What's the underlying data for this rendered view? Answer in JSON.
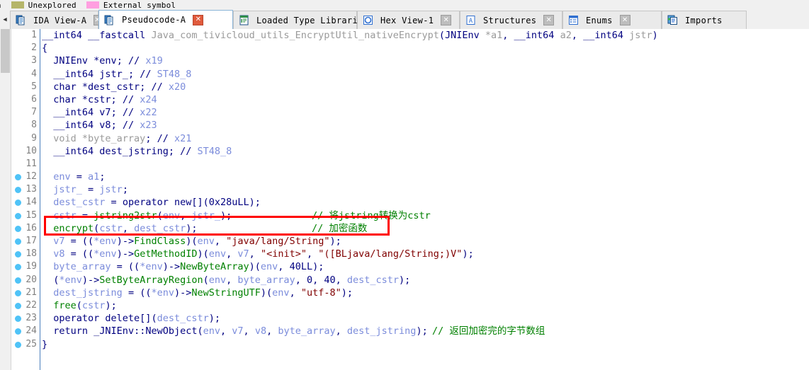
{
  "legend": {
    "truncated_prefix": "ta",
    "items": [
      {
        "label": "Unexplored",
        "color": "#b5b56a"
      },
      {
        "label": "External symbol",
        "color": "#ff9fe0"
      }
    ]
  },
  "tabbar": {
    "scroll_glyph": "◀",
    "close_glyph": "✕",
    "tabs": [
      {
        "label": "IDA View-A",
        "icon": "document-view-icon",
        "active": false,
        "closable": true
      },
      {
        "label": "Pseudocode-A",
        "icon": "pseudocode-icon",
        "active": true,
        "closable": true
      },
      {
        "label": "Loaded Type Libraries",
        "icon": "type-libraries-icon",
        "active": false,
        "closable": true
      },
      {
        "label": "Hex View-1",
        "icon": "hex-view-icon",
        "active": false,
        "closable": true
      },
      {
        "label": "Structures",
        "icon": "structures-icon",
        "active": false,
        "closable": true
      },
      {
        "label": "Enums",
        "icon": "enums-icon",
        "active": false,
        "closable": true
      },
      {
        "label": "Imports",
        "icon": "imports-icon",
        "active": false,
        "closable": false
      }
    ]
  },
  "annotation": {
    "color": "#ff0000",
    "target_line": 16,
    "label": "encrypt-call-highlight"
  },
  "editor": {
    "function_name": "Java_com_tivicloud_utils_EncryptUtil_nativeEncrypt",
    "breakpoint_lines": [
      12,
      13,
      14,
      15,
      16,
      17,
      18,
      19,
      20,
      21,
      22,
      23,
      24,
      25
    ],
    "lines": [
      {
        "n": 1,
        "tokens": [
          {
            "t": "__int64 ",
            "c": "kw"
          },
          {
            "t": "__fastcall ",
            "c": "kw"
          },
          {
            "t": "Java_com_tivicloud_utils_EncryptUtil_nativeEncrypt",
            "c": "gray"
          },
          {
            "t": "(",
            "c": "pun"
          },
          {
            "t": "JNIEnv ",
            "c": "kw"
          },
          {
            "t": "*a1",
            "c": "gray"
          },
          {
            "t": ", ",
            "c": "pun"
          },
          {
            "t": "__int64 ",
            "c": "kw"
          },
          {
            "t": "a2",
            "c": "gray"
          },
          {
            "t": ", ",
            "c": "pun"
          },
          {
            "t": "__int64 ",
            "c": "kw"
          },
          {
            "t": "jstr",
            "c": "gray"
          },
          {
            "t": ")",
            "c": "pun"
          }
        ],
        "comment": ""
      },
      {
        "n": 2,
        "tokens": [
          {
            "t": "{",
            "c": "kw"
          }
        ],
        "comment": ""
      },
      {
        "n": 3,
        "tokens": [
          {
            "t": "  ",
            "c": "pun"
          },
          {
            "t": "JNIEnv ",
            "c": "kw"
          },
          {
            "t": "*env",
            "c": "kw"
          },
          {
            "t": "; ",
            "c": "pun"
          },
          {
            "t": "// ",
            "c": "kw"
          },
          {
            "t": "x19",
            "c": "var"
          }
        ],
        "comment": ""
      },
      {
        "n": 4,
        "tokens": [
          {
            "t": "  ",
            "c": "pun"
          },
          {
            "t": "__int64 ",
            "c": "kw"
          },
          {
            "t": "jstr_",
            "c": "kw"
          },
          {
            "t": "; ",
            "c": "pun"
          },
          {
            "t": "// ",
            "c": "kw"
          },
          {
            "t": "ST48_8",
            "c": "var"
          }
        ],
        "comment": ""
      },
      {
        "n": 5,
        "tokens": [
          {
            "t": "  ",
            "c": "pun"
          },
          {
            "t": "char ",
            "c": "kw"
          },
          {
            "t": "*dest_cstr",
            "c": "kw"
          },
          {
            "t": "; ",
            "c": "pun"
          },
          {
            "t": "// ",
            "c": "kw"
          },
          {
            "t": "x20",
            "c": "var"
          }
        ],
        "comment": ""
      },
      {
        "n": 6,
        "tokens": [
          {
            "t": "  ",
            "c": "pun"
          },
          {
            "t": "char ",
            "c": "kw"
          },
          {
            "t": "*cstr",
            "c": "kw"
          },
          {
            "t": "; ",
            "c": "pun"
          },
          {
            "t": "// ",
            "c": "kw"
          },
          {
            "t": "x24",
            "c": "var"
          }
        ],
        "comment": ""
      },
      {
        "n": 7,
        "tokens": [
          {
            "t": "  ",
            "c": "pun"
          },
          {
            "t": "__int64 ",
            "c": "kw"
          },
          {
            "t": "v7",
            "c": "kw"
          },
          {
            "t": "; ",
            "c": "pun"
          },
          {
            "t": "// ",
            "c": "kw"
          },
          {
            "t": "x22",
            "c": "var"
          }
        ],
        "comment": ""
      },
      {
        "n": 8,
        "tokens": [
          {
            "t": "  ",
            "c": "pun"
          },
          {
            "t": "__int64 ",
            "c": "kw"
          },
          {
            "t": "v8",
            "c": "kw"
          },
          {
            "t": "; ",
            "c": "pun"
          },
          {
            "t": "// ",
            "c": "kw"
          },
          {
            "t": "x23",
            "c": "var"
          }
        ],
        "comment": ""
      },
      {
        "n": 9,
        "tokens": [
          {
            "t": "  ",
            "c": "pun"
          },
          {
            "t": "void ",
            "c": "gray"
          },
          {
            "t": "*byte_array",
            "c": "gray"
          },
          {
            "t": "; ",
            "c": "pun"
          },
          {
            "t": "// ",
            "c": "kw"
          },
          {
            "t": "x21",
            "c": "var"
          }
        ],
        "comment": ""
      },
      {
        "n": 10,
        "tokens": [
          {
            "t": "  ",
            "c": "pun"
          },
          {
            "t": "__int64 ",
            "c": "kw"
          },
          {
            "t": "dest_jstring",
            "c": "kw"
          },
          {
            "t": "; ",
            "c": "pun"
          },
          {
            "t": "// ",
            "c": "kw"
          },
          {
            "t": "ST48_8",
            "c": "var"
          }
        ],
        "comment": ""
      },
      {
        "n": 11,
        "tokens": [],
        "comment": ""
      },
      {
        "n": 12,
        "tokens": [
          {
            "t": "  ",
            "c": "pun"
          },
          {
            "t": "env",
            "c": "var"
          },
          {
            "t": " = ",
            "c": "pun"
          },
          {
            "t": "a1",
            "c": "var"
          },
          {
            "t": ";",
            "c": "pun"
          }
        ],
        "comment": ""
      },
      {
        "n": 13,
        "tokens": [
          {
            "t": "  ",
            "c": "pun"
          },
          {
            "t": "jstr_",
            "c": "var"
          },
          {
            "t": " = ",
            "c": "pun"
          },
          {
            "t": "jstr",
            "c": "var"
          },
          {
            "t": ";",
            "c": "pun"
          }
        ],
        "comment": ""
      },
      {
        "n": 14,
        "tokens": [
          {
            "t": "  ",
            "c": "pun"
          },
          {
            "t": "dest_cstr",
            "c": "var"
          },
          {
            "t": " = ",
            "c": "pun"
          },
          {
            "t": "operator new[]",
            "c": "kw"
          },
          {
            "t": "(",
            "c": "pun"
          },
          {
            "t": "0x28uLL",
            "c": "num"
          },
          {
            "t": ");",
            "c": "pun"
          }
        ],
        "comment": ""
      },
      {
        "n": 15,
        "tokens": [
          {
            "t": "  ",
            "c": "pun"
          },
          {
            "t": "cstr",
            "c": "var"
          },
          {
            "t": " = ",
            "c": "pun"
          },
          {
            "t": "jstring2str",
            "c": "fn"
          },
          {
            "t": "(",
            "c": "pun"
          },
          {
            "t": "env",
            "c": "var"
          },
          {
            "t": ", ",
            "c": "pun"
          },
          {
            "t": "jstr_",
            "c": "var"
          },
          {
            "t": ");",
            "c": "pun"
          }
        ],
        "comment": "// 将jstring转换为cstr"
      },
      {
        "n": 16,
        "tokens": [
          {
            "t": "  ",
            "c": "pun"
          },
          {
            "t": "encrypt",
            "c": "fn"
          },
          {
            "t": "(",
            "c": "pun"
          },
          {
            "t": "cstr",
            "c": "var"
          },
          {
            "t": ", ",
            "c": "pun"
          },
          {
            "t": "dest_cstr",
            "c": "var"
          },
          {
            "t": ");",
            "c": "pun"
          }
        ],
        "comment": "// 加密函数"
      },
      {
        "n": 17,
        "tokens": [
          {
            "t": "  ",
            "c": "pun"
          },
          {
            "t": "v7",
            "c": "var"
          },
          {
            "t": " = ((",
            "c": "pun"
          },
          {
            "t": "*env",
            "c": "var"
          },
          {
            "t": ")->",
            "c": "pun"
          },
          {
            "t": "FindClass",
            "c": "fn"
          },
          {
            "t": ")(",
            "c": "pun"
          },
          {
            "t": "env",
            "c": "var"
          },
          {
            "t": ", ",
            "c": "pun"
          },
          {
            "t": "\"java/lang/String\"",
            "c": "str"
          },
          {
            "t": ");",
            "c": "pun"
          }
        ],
        "comment": ""
      },
      {
        "n": 18,
        "tokens": [
          {
            "t": "  ",
            "c": "pun"
          },
          {
            "t": "v8",
            "c": "var"
          },
          {
            "t": " = ((",
            "c": "pun"
          },
          {
            "t": "*env",
            "c": "var"
          },
          {
            "t": ")->",
            "c": "pun"
          },
          {
            "t": "GetMethodID",
            "c": "fn"
          },
          {
            "t": ")(",
            "c": "pun"
          },
          {
            "t": "env",
            "c": "var"
          },
          {
            "t": ", ",
            "c": "pun"
          },
          {
            "t": "v7",
            "c": "var"
          },
          {
            "t": ", ",
            "c": "pun"
          },
          {
            "t": "\"<init>\"",
            "c": "str"
          },
          {
            "t": ", ",
            "c": "pun"
          },
          {
            "t": "\"([BLjava/lang/String;)V\"",
            "c": "str"
          },
          {
            "t": ");",
            "c": "pun"
          }
        ],
        "comment": ""
      },
      {
        "n": 19,
        "tokens": [
          {
            "t": "  ",
            "c": "pun"
          },
          {
            "t": "byte_array",
            "c": "var"
          },
          {
            "t": " = ((",
            "c": "pun"
          },
          {
            "t": "*env",
            "c": "var"
          },
          {
            "t": ")->",
            "c": "pun"
          },
          {
            "t": "NewByteArray",
            "c": "fn"
          },
          {
            "t": ")(",
            "c": "pun"
          },
          {
            "t": "env",
            "c": "var"
          },
          {
            "t": ", ",
            "c": "pun"
          },
          {
            "t": "40LL",
            "c": "num"
          },
          {
            "t": ");",
            "c": "pun"
          }
        ],
        "comment": ""
      },
      {
        "n": 20,
        "tokens": [
          {
            "t": "  (",
            "c": "pun"
          },
          {
            "t": "*env",
            "c": "var"
          },
          {
            "t": ")->",
            "c": "pun"
          },
          {
            "t": "SetByteArrayRegion",
            "c": "fn"
          },
          {
            "t": "(",
            "c": "pun"
          },
          {
            "t": "env",
            "c": "var"
          },
          {
            "t": ", ",
            "c": "pun"
          },
          {
            "t": "byte_array",
            "c": "var"
          },
          {
            "t": ", ",
            "c": "pun"
          },
          {
            "t": "0",
            "c": "num"
          },
          {
            "t": ", ",
            "c": "pun"
          },
          {
            "t": "40",
            "c": "num"
          },
          {
            "t": ", ",
            "c": "pun"
          },
          {
            "t": "dest_cstr",
            "c": "var"
          },
          {
            "t": ");",
            "c": "pun"
          }
        ],
        "comment": ""
      },
      {
        "n": 21,
        "tokens": [
          {
            "t": "  ",
            "c": "pun"
          },
          {
            "t": "dest_jstring",
            "c": "var"
          },
          {
            "t": " = ((",
            "c": "pun"
          },
          {
            "t": "*env",
            "c": "var"
          },
          {
            "t": ")->",
            "c": "pun"
          },
          {
            "t": "NewStringUTF",
            "c": "fn"
          },
          {
            "t": ")(",
            "c": "pun"
          },
          {
            "t": "env",
            "c": "var"
          },
          {
            "t": ", ",
            "c": "pun"
          },
          {
            "t": "\"utf-8\"",
            "c": "str"
          },
          {
            "t": ");",
            "c": "pun"
          }
        ],
        "comment": ""
      },
      {
        "n": 22,
        "tokens": [
          {
            "t": "  ",
            "c": "pun"
          },
          {
            "t": "free",
            "c": "fn"
          },
          {
            "t": "(",
            "c": "pun"
          },
          {
            "t": "cstr",
            "c": "var"
          },
          {
            "t": ");",
            "c": "pun"
          }
        ],
        "comment": ""
      },
      {
        "n": 23,
        "tokens": [
          {
            "t": "  ",
            "c": "pun"
          },
          {
            "t": "operator delete[]",
            "c": "kw"
          },
          {
            "t": "(",
            "c": "pun"
          },
          {
            "t": "dest_cstr",
            "c": "var"
          },
          {
            "t": ");",
            "c": "pun"
          }
        ],
        "comment": ""
      },
      {
        "n": 24,
        "tokens": [
          {
            "t": "  ",
            "c": "pun"
          },
          {
            "t": "return ",
            "c": "kw"
          },
          {
            "t": "_JNIEnv::NewObject",
            "c": "kw"
          },
          {
            "t": "(",
            "c": "pun"
          },
          {
            "t": "env",
            "c": "var"
          },
          {
            "t": ", ",
            "c": "pun"
          },
          {
            "t": "v7",
            "c": "var"
          },
          {
            "t": ", ",
            "c": "pun"
          },
          {
            "t": "v8",
            "c": "var"
          },
          {
            "t": ", ",
            "c": "pun"
          },
          {
            "t": "byte_array",
            "c": "var"
          },
          {
            "t": ", ",
            "c": "pun"
          },
          {
            "t": "dest_jstring",
            "c": "var"
          },
          {
            "t": ");",
            "c": "pun"
          }
        ],
        "comment": "// 返回加密完的字节数组",
        "comment_inline": true
      },
      {
        "n": 25,
        "tokens": [
          {
            "t": "}",
            "c": "kw"
          }
        ],
        "comment": ""
      }
    ]
  }
}
